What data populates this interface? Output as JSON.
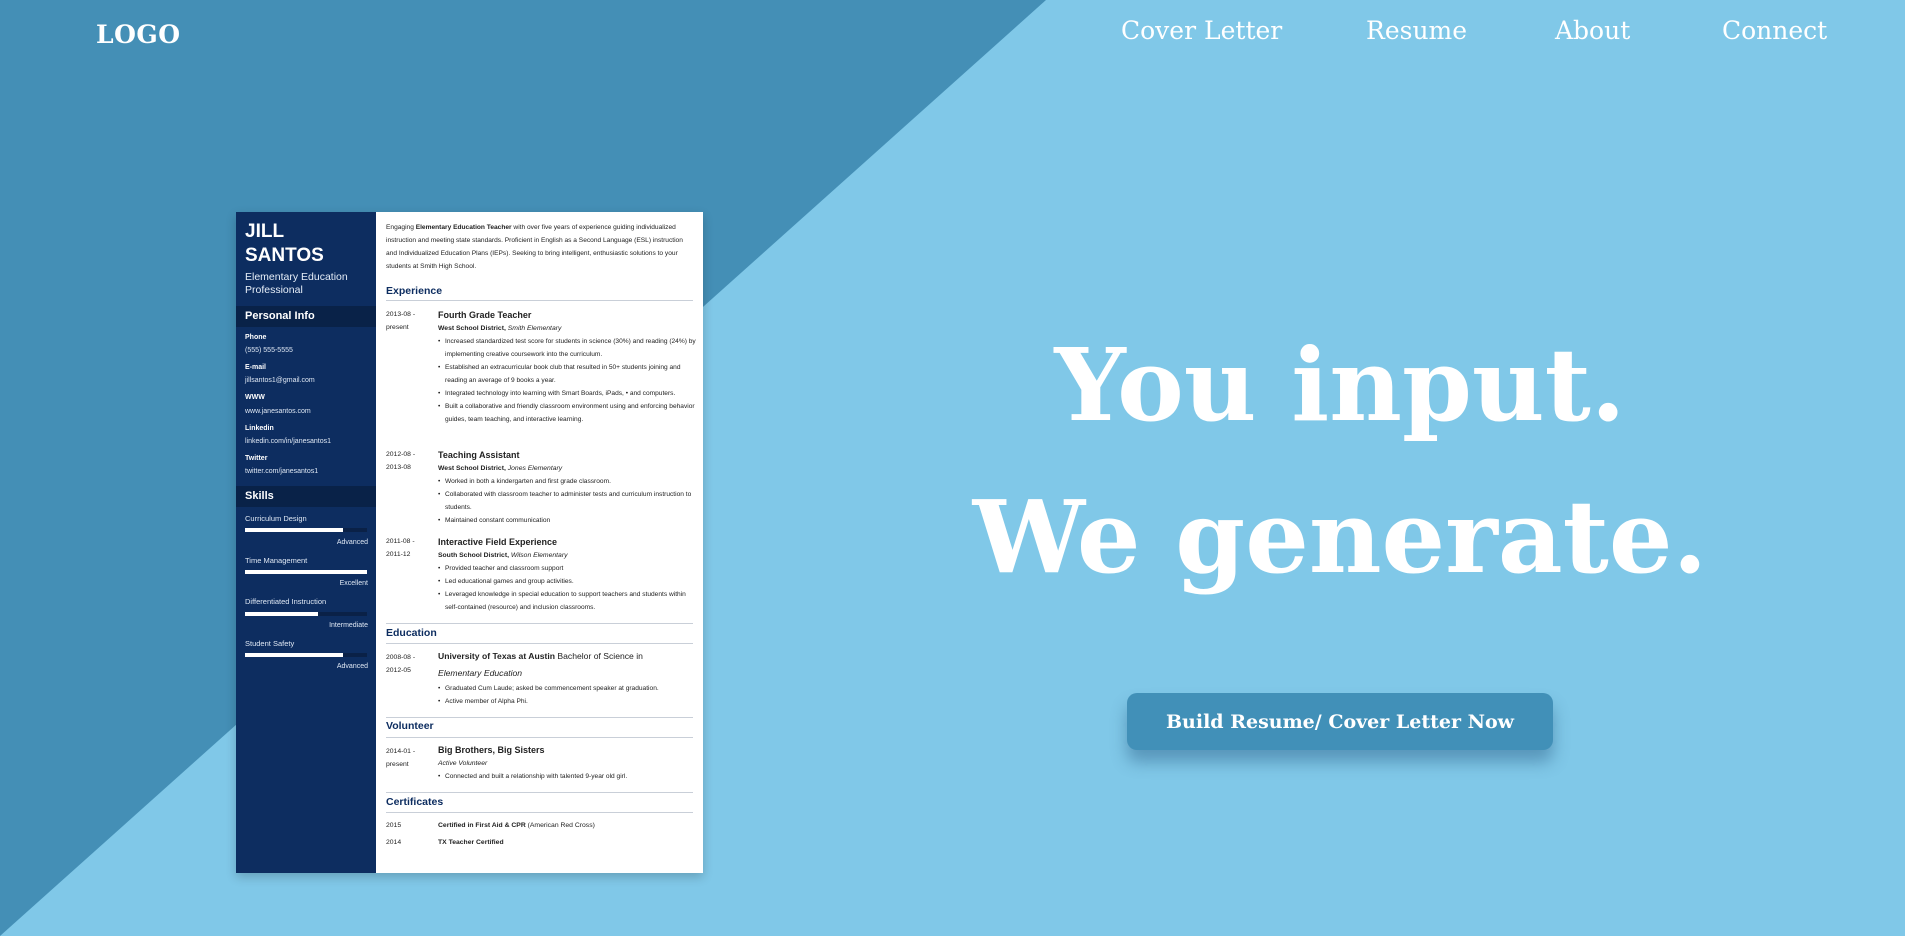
{
  "nav": {
    "logo": "LOGO",
    "links": [
      "Cover Letter",
      "Resume",
      "About",
      "Connect"
    ]
  },
  "hero": {
    "line1": "You input.",
    "line2": "We generate.",
    "cta": "Build Resume/ Cover Letter Now"
  },
  "colors": {
    "background_light": "#80c8e8",
    "background_dark": "#448fb6",
    "resume_sidebar": "#0d2d60",
    "button": "#4190b8"
  },
  "resume": {
    "name_line1": "JILL",
    "name_line2": "SANTOS",
    "title": "Elementary Education Professional",
    "personal_info_heading": "Personal Info",
    "personal": [
      {
        "label": "Phone",
        "value": "(555) 555-5555"
      },
      {
        "label": "E-mail",
        "value": "jillsantos1@gmail.com"
      },
      {
        "label": "WWW",
        "value": "www.janesantos.com"
      },
      {
        "label": "Linkedin",
        "value": "linkedin.com/in/janesantos1"
      },
      {
        "label": "Twitter",
        "value": "twitter.com/janesantos1"
      }
    ],
    "skills_heading": "Skills",
    "skills": [
      {
        "name": "Curriculum Design",
        "level": "Advanced",
        "fill": 0.8
      },
      {
        "name": "Time Management",
        "level": "Excellent",
        "fill": 1.0
      },
      {
        "name": "Differentiated Instruction",
        "level": "Intermediate",
        "fill": 0.6
      },
      {
        "name": "Student Safety",
        "level": "Advanced",
        "fill": 0.8
      }
    ],
    "summary_pre": "Engaging ",
    "summary_bold": "Elementary Education Teacher",
    "summary_post": " with over five years of experience guiding individualized instruction and meeting state standards. Proficient in English as a Second Language (ESL) instruction and Individualized Education Plans (IEPs). Seeking to bring intelligent, enthusiastic solutions to your students at Smith High School.",
    "experience_heading": "Experience",
    "experience": [
      {
        "dates": "2013-08 - present",
        "title": "Fourth Grade Teacher",
        "org": "West School District,",
        "place": "Smith Elementary",
        "bullets": [
          "Increased standardized test score for students in science (30%) and reading (24%) by implementing creative coursework into the curriculum.",
          "Established an extracurricular book club that resulted in 50+ students joining and reading an average of 9 books a year.",
          "Integrated technology into learning with Smart Boards, iPads, • and computers.",
          "Built a collaborative and friendly classroom environment using and enforcing behavior guides, team teaching, and interactive learning."
        ]
      },
      {
        "dates": "2012-08 - 2013-08",
        "title": "Teaching Assistant",
        "org": "West School District,",
        "place": "Jones Elementary",
        "bullets": [
          "Worked in both a kindergarten and first grade classroom.",
          "Collaborated with classroom teacher to administer tests and curriculum instruction to students.",
          "Maintained constant communication"
        ]
      },
      {
        "dates": "2011-08 - 2011-12",
        "title": "Interactive Field Experience",
        "org": "South School District,",
        "place": "Wilson Elementary",
        "bullets": [
          "Provided teacher and classroom support",
          "Led educational games and group activities.",
          "Leveraged knowledge in special education to support teachers and students within self-contained (resource) and inclusion classrooms."
        ]
      }
    ],
    "education_heading": "Education",
    "education": {
      "dates": "2008-08 - 2012-05",
      "school": "University of Texas at Austin",
      "degree": " Bachelor of Science in ",
      "field": "Elementary Education",
      "bullets": [
        "Graduated Cum Laude; asked be commencement speaker at graduation.",
        "Active member of Alpha Phi."
      ]
    },
    "volunteer_heading": "Volunteer",
    "volunteer": {
      "dates": "2014-01 - present",
      "org": "Big Brothers, Big Sisters",
      "role": "Active Volunteer",
      "bullets": [
        "Connected and built a relationship with talented 9-year old girl."
      ]
    },
    "certificates_heading": "Certificates",
    "certificates": [
      {
        "year": "2015",
        "name": "Certified in First Aid & CPR",
        "issuer": " (American Red Cross)"
      },
      {
        "year": "2014",
        "name": "TX Teacher Certified",
        "issuer": ""
      }
    ]
  }
}
